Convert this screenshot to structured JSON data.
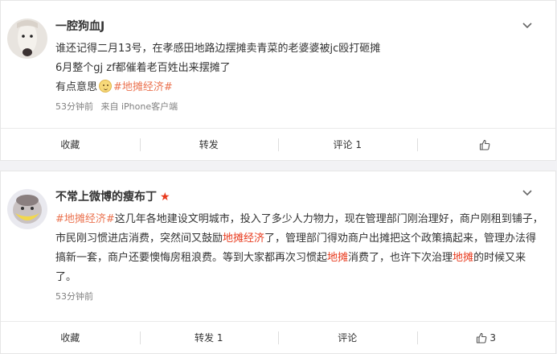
{
  "posts": [
    {
      "username": "一腔狗血J",
      "lines": [
        "谁还记得二月13号，在孝感田地路边摆摊卖青菜的老婆婆被jc殴打砸摊",
        "6月整个gj zf都催着老百姓出来摆摊了"
      ],
      "line3_prefix": "有点意思",
      "hashtag": "#地摊经济#",
      "time": "53分钟前",
      "source": "来自 iPhone客户端",
      "actions": {
        "collect": "收藏",
        "repost": "转发",
        "comment": "评论 1",
        "like_count": ""
      }
    },
    {
      "username": "不常上微博的瘦布丁",
      "verified_star": "★",
      "hashtag": "#地摊经济#",
      "text_a": "这几年各地建设文明城市，投入了多少人力物力，现在管理部门刚治理好，商户刚租到铺子，市民刚习惯进店消费，突然间又鼓励",
      "kw1": "地摊经济",
      "text_b": "了，管理部门得劝商户出摊把这个政策搞起来，管理办法得搞新一套，商户还要懊悔房租浪费。等到大家都再次习惯起",
      "kw2": "地摊",
      "text_c": "消费了，也许下次治理",
      "kw3": "地摊",
      "text_d": "的时候又来了。",
      "time": "53分钟前",
      "actions": {
        "collect": "收藏",
        "repost": "转发 1",
        "comment": "评论",
        "like_count": "3"
      }
    }
  ],
  "icons": {
    "more": "chevron-down-icon",
    "like": "thumbs-up-icon",
    "emoji": "smiley-emoji-icon"
  },
  "colors": {
    "hashtag": "#eb7350",
    "keyword": "#e8391c",
    "meta": "#808080"
  }
}
